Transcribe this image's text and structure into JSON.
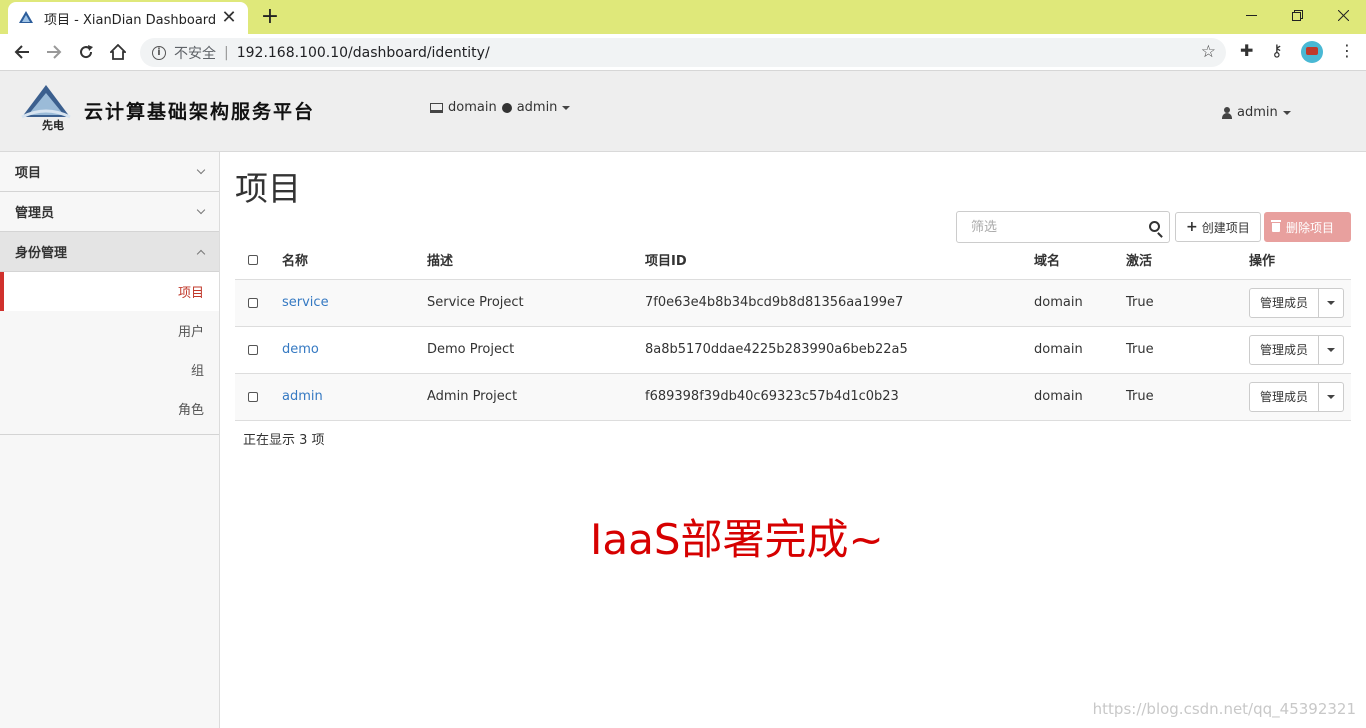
{
  "browser": {
    "tab_title": "项目 - XianDian Dashboard",
    "tab_close": "✕",
    "new_tab": "+",
    "security_label": "不安全",
    "url": "192.168.100.10/dashboard/identity/"
  },
  "header": {
    "brand": "云计算基础架构服务平台",
    "logo_caption": "先电",
    "domain": "domain",
    "project": "admin",
    "user": "admin"
  },
  "sidebar": {
    "sections": [
      {
        "label": "项目"
      },
      {
        "label": "管理员"
      },
      {
        "label": "身份管理"
      }
    ],
    "links": [
      {
        "label": "项目"
      },
      {
        "label": "用户"
      },
      {
        "label": "组"
      },
      {
        "label": "角色"
      }
    ]
  },
  "main": {
    "title": "项目",
    "filter_placeholder": "筛选",
    "create_label": "创建项目",
    "delete_label": "删除项目",
    "columns": [
      "名称",
      "描述",
      "项目ID",
      "域名",
      "激活",
      "操作"
    ],
    "rows": [
      {
        "name": "service",
        "description": "Service Project",
        "id": "7f0e63e4b8b34bcd9b8d81356aa199e7",
        "domain": "domain",
        "enabled": "True",
        "action": "管理成员"
      },
      {
        "name": "demo",
        "description": "Demo Project",
        "id": "8a8b5170ddae4225b283990a6beb22a5",
        "domain": "domain",
        "enabled": "True",
        "action": "管理成员"
      },
      {
        "name": "admin",
        "description": "Admin Project",
        "id": "f689398f39db40c69323c57b4d1c0b23",
        "domain": "domain",
        "enabled": "True",
        "action": "管理成员"
      }
    ],
    "footer": "正在显示 3 项"
  },
  "overlay": {
    "text": "IaaS部署完成~"
  },
  "watermark": "https://blog.csdn.net/qq_45392321"
}
